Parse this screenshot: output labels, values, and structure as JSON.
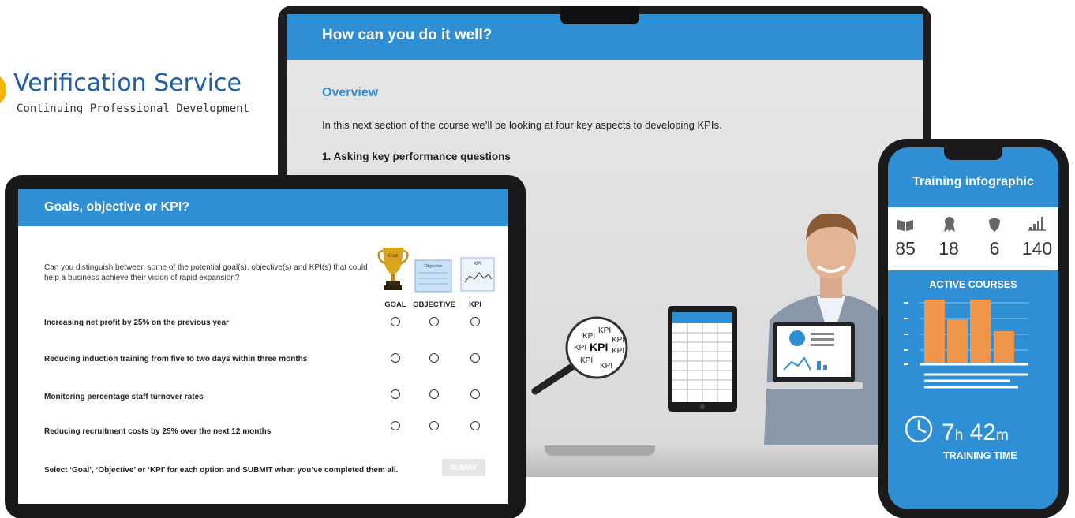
{
  "branding": {
    "title": "Verification Service",
    "subtitle": "Continuing Professional Development"
  },
  "laptop": {
    "header": "How can you do it well?",
    "section_title": "Overview",
    "intro": "In this next section of the course we’ll be looking at four key aspects to developing KPIs.",
    "point_1": "1. Asking key performance questions",
    "magnifier_labels": [
      "KPI",
      "KPI",
      "KPI",
      "KPI",
      "KPI",
      "KPI",
      "KPI",
      "KPI"
    ]
  },
  "tablet": {
    "header": "Goals, objective or KPI?",
    "question": "Can you distinguish between some of the potential goal(s), objective(s) and KPI(s) that could help a business achieve their vision of rapid expansion?",
    "icon_labels": {
      "goal": "Goal",
      "objective": "Objective",
      "kpi": "KPI"
    },
    "columns": [
      "GOAL",
      "OBJECTIVE",
      "KPI"
    ],
    "rows": [
      "Increasing net profit by 25% on the previous year",
      "Reducing induction training from five to two days within three months",
      "Monitoring percentage staff turnover rates",
      "Reducing recruitment costs by 25% over the next 12 months"
    ],
    "footer": "Select ‘Goal’, ‘Objective’ or ‘KPI’ for each option and SUBMIT when you’ve completed them all.",
    "submit_label": "SUBMIT"
  },
  "phone": {
    "title": "Training infographic",
    "stats": [
      {
        "icon": "book-icon",
        "value": "85"
      },
      {
        "icon": "award-icon",
        "value": "18"
      },
      {
        "icon": "shield-icon",
        "value": "6"
      },
      {
        "icon": "bar-signal-icon",
        "value": "140"
      }
    ],
    "active_courses_label": "ACTIVE COURSES",
    "time_hours": "7",
    "time_hours_unit": "h",
    "time_minutes": "42",
    "time_minutes_unit": "m",
    "time_label": "TRAINING TIME"
  },
  "colors": {
    "accent_blue": "#2f8fd5",
    "brand_blue": "#1f5fa8",
    "bar_orange": "#f0964a"
  }
}
